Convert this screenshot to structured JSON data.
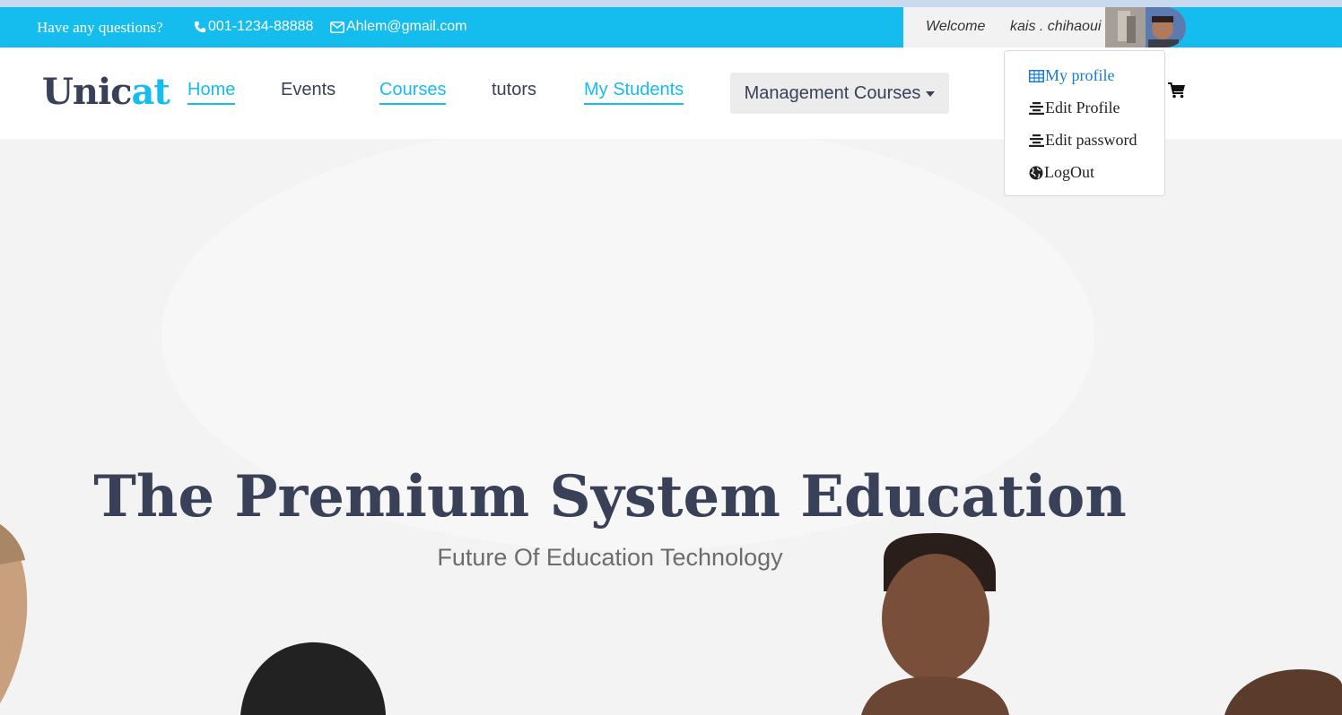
{
  "topbar": {
    "question": "Have any questions?",
    "phone": "001-1234-88888",
    "email": "Ahlem@gmail.com",
    "welcome": "Welcome",
    "username": "kais . chihaoui"
  },
  "nav": {
    "logo_main": "Unic",
    "logo_accent": "at",
    "links": [
      "Home",
      "Events",
      "Courses",
      "tutors",
      "My Students"
    ],
    "management": "Management Courses"
  },
  "dropdown": {
    "items": [
      "My profile",
      "Edit Profile",
      "Edit password",
      "LogOut"
    ]
  },
  "hero": {
    "title": "The Premium System Education",
    "subtitle": "Future Of Education Technology"
  },
  "colors": {
    "accent": "#14bdee",
    "dark": "#384158",
    "link_highlight": "#1a7bd4"
  }
}
